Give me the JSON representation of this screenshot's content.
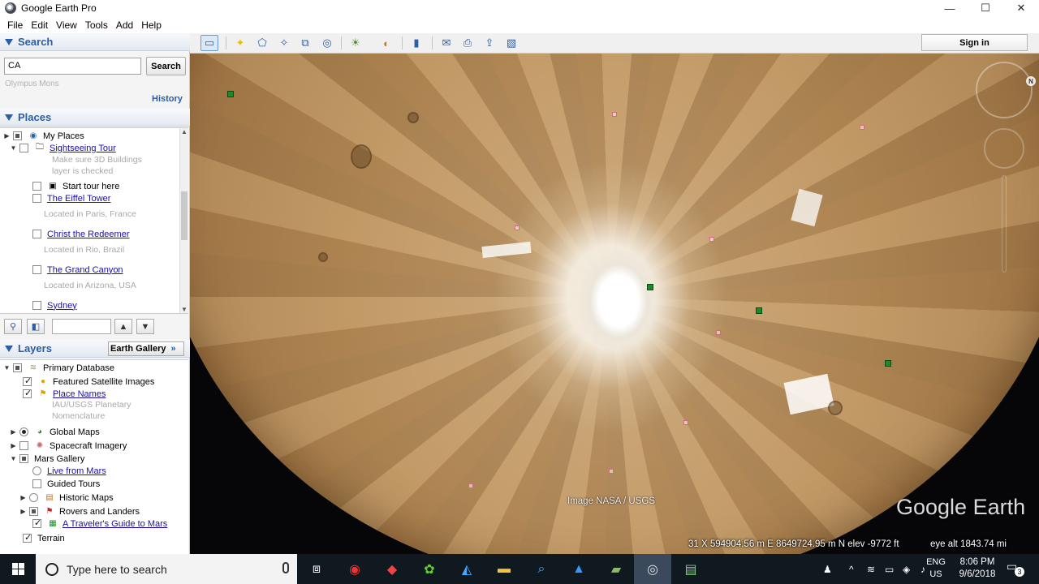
{
  "window": {
    "title": "Google Earth Pro",
    "minimize": "—",
    "maximize": "☐",
    "close": "✕"
  },
  "menu": {
    "file": "File",
    "edit": "Edit",
    "view": "View",
    "tools": "Tools",
    "add": "Add",
    "help": "Help"
  },
  "search": {
    "header": "Search",
    "input_value": "CA",
    "button": "Search",
    "hint": "Olympus Mons",
    "history": "History"
  },
  "places": {
    "header": "Places",
    "my_places": "My Places",
    "tour": "Sightseeing Tour",
    "tour_desc_1": "Make sure 3D Buildings",
    "tour_desc_2": "layer is checked",
    "start_tour": "Start tour here",
    "items": [
      {
        "label": "The Eiffel Tower",
        "desc": "Located in Paris, France"
      },
      {
        "label": "Christ the Redeemer",
        "desc": "Located in Rio, Brazil"
      },
      {
        "label": "The Grand Canyon",
        "desc": "Located in Arizona, USA"
      },
      {
        "label": "Sydney"
      }
    ]
  },
  "layers": {
    "header": "Layers",
    "gallery_button": "Earth Gallery",
    "primary_db": "Primary Database",
    "featured": "Featured Satellite Images",
    "place_names": "Place Names",
    "iau_1": "IAU/USGS Planetary",
    "iau_2": "Nomenclature",
    "global_maps": "Global Maps",
    "spacecraft": "Spacecraft Imagery",
    "mars_gallery": "Mars Gallery",
    "live_mars": "Live from Mars",
    "guided_tours": "Guided Tours",
    "historic_maps": "Historic Maps",
    "rovers": "Rovers and Landers",
    "travelers_guide": "A Traveler's Guide to Mars",
    "terrain": "Terrain"
  },
  "toolbar": {
    "sign_in": "Sign in"
  },
  "view": {
    "credit": "Image NASA / USGS",
    "brand": "Google Earth",
    "coords": "31 X 594904.56 m E 8649724.95 m N  elev -9772 ft",
    "eye_alt": "eye alt 1843.74 mi",
    "compass_letter": "N"
  },
  "taskbar": {
    "search_placeholder": "Type here to search",
    "lang_1": "ENG",
    "lang_2": "US",
    "time": "8:06 PM",
    "date": "9/6/2018",
    "notifications": "3"
  },
  "colors": {
    "accent": "#2a5ea8",
    "link": "#1a0dab",
    "taskbar": "#101820"
  }
}
